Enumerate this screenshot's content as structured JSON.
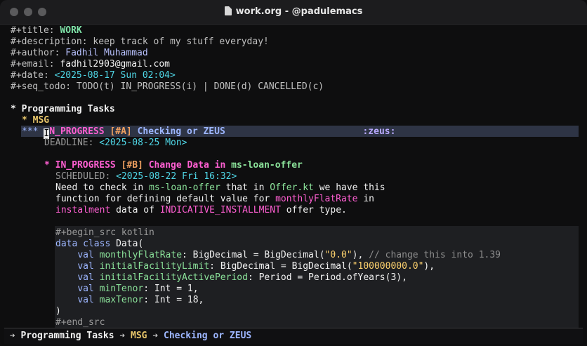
{
  "window": {
    "title": "work.org - @padulemacs",
    "colors": {
      "bg": "#0e0e0f",
      "highlight": "#2e3445",
      "src_bg": "#1e1f22"
    }
  },
  "header": {
    "title_key": "#+title:",
    "title_value": "WORK",
    "desc_key": "#+description:",
    "desc_value": "keep track of my stuff everyday!",
    "author_key": "#+author:",
    "author_value": "Fadhil Muhammad",
    "email_key": "#+email:",
    "email_value": "fadhil2903@gmail.com",
    "date_key": "#+date:",
    "date_value": "<2025-08-17 Sun 02:04>",
    "seq_key": "#+seq_todo:",
    "seq_value": "TODO(t) IN_PROGRESS(i) | DONE(d) CANCELLED(c)"
  },
  "outline": {
    "h1_star": "*",
    "h1_title": "Programming Tasks",
    "h2_star": "*",
    "h2_title": "MSG",
    "h3_stars": "***",
    "h3_first_char": "I",
    "h3_state_rest": "N_PROGRESS",
    "h3_priority": "[#A]",
    "h3_title": "Checking or ZEUS",
    "h3_tag": ":zeus:",
    "h3_deadline_key": "DEADLINE:",
    "h3_deadline_value": "<2025-08-25 Mon>",
    "t2_star": "*",
    "t2_state": "IN_PROGRESS",
    "t2_priority": "[#B]",
    "t2_title_a": "Change Data in",
    "t2_title_b": "ms-loan-offer",
    "t2_sched_key": "SCHEDULED:",
    "t2_sched_value": "<2025-08-22 Fri 16:32>",
    "body1_a": "Need to check in",
    "body1_b": "ms-loan-offer",
    "body1_c": "that in",
    "body1_d": "Offer.kt",
    "body1_e": "we have this",
    "body2_a": "function for defining default value for",
    "body2_b": "monthlyFlatRate",
    "body2_c": "in",
    "body3_a": "instalment",
    "body3_b": "data of",
    "body3_c": "INDICATIVE_INSTALLMENT",
    "body3_d": "offer type."
  },
  "code": {
    "begin": "#+begin_src kotlin",
    "l1_a": "data class",
    "l1_b": "Data(",
    "l2_a": "val",
    "l2_b": "monthlyFlatRate",
    "l2_c": ": BigDecimal = BigDecimal(",
    "l2_d": "\"0.0\"",
    "l2_e": "), ",
    "l2_f": "// change this into 1.39",
    "l3_a": "val",
    "l3_b": "initialFacilityLimit",
    "l3_c": ": BigDecimal = BigDecimal(",
    "l3_d": "\"100000000.0\"",
    "l3_e": "),",
    "l4_a": "val",
    "l4_b": "initialFacilityActivePeriod",
    "l4_c": ": Period = Period.ofYears(3),",
    "l5_a": "val",
    "l5_b": "minTenor",
    "l5_c": ": Int = 1,",
    "l6_a": "val",
    "l6_b": "maxTenor",
    "l6_c": ": Int = 18,",
    "l7": ")",
    "end": "#+end_src"
  },
  "modeline": {
    "sep": "➔",
    "crumb1": "Programming Tasks",
    "crumb2": "MSG",
    "crumb3": "Checking or ZEUS"
  }
}
